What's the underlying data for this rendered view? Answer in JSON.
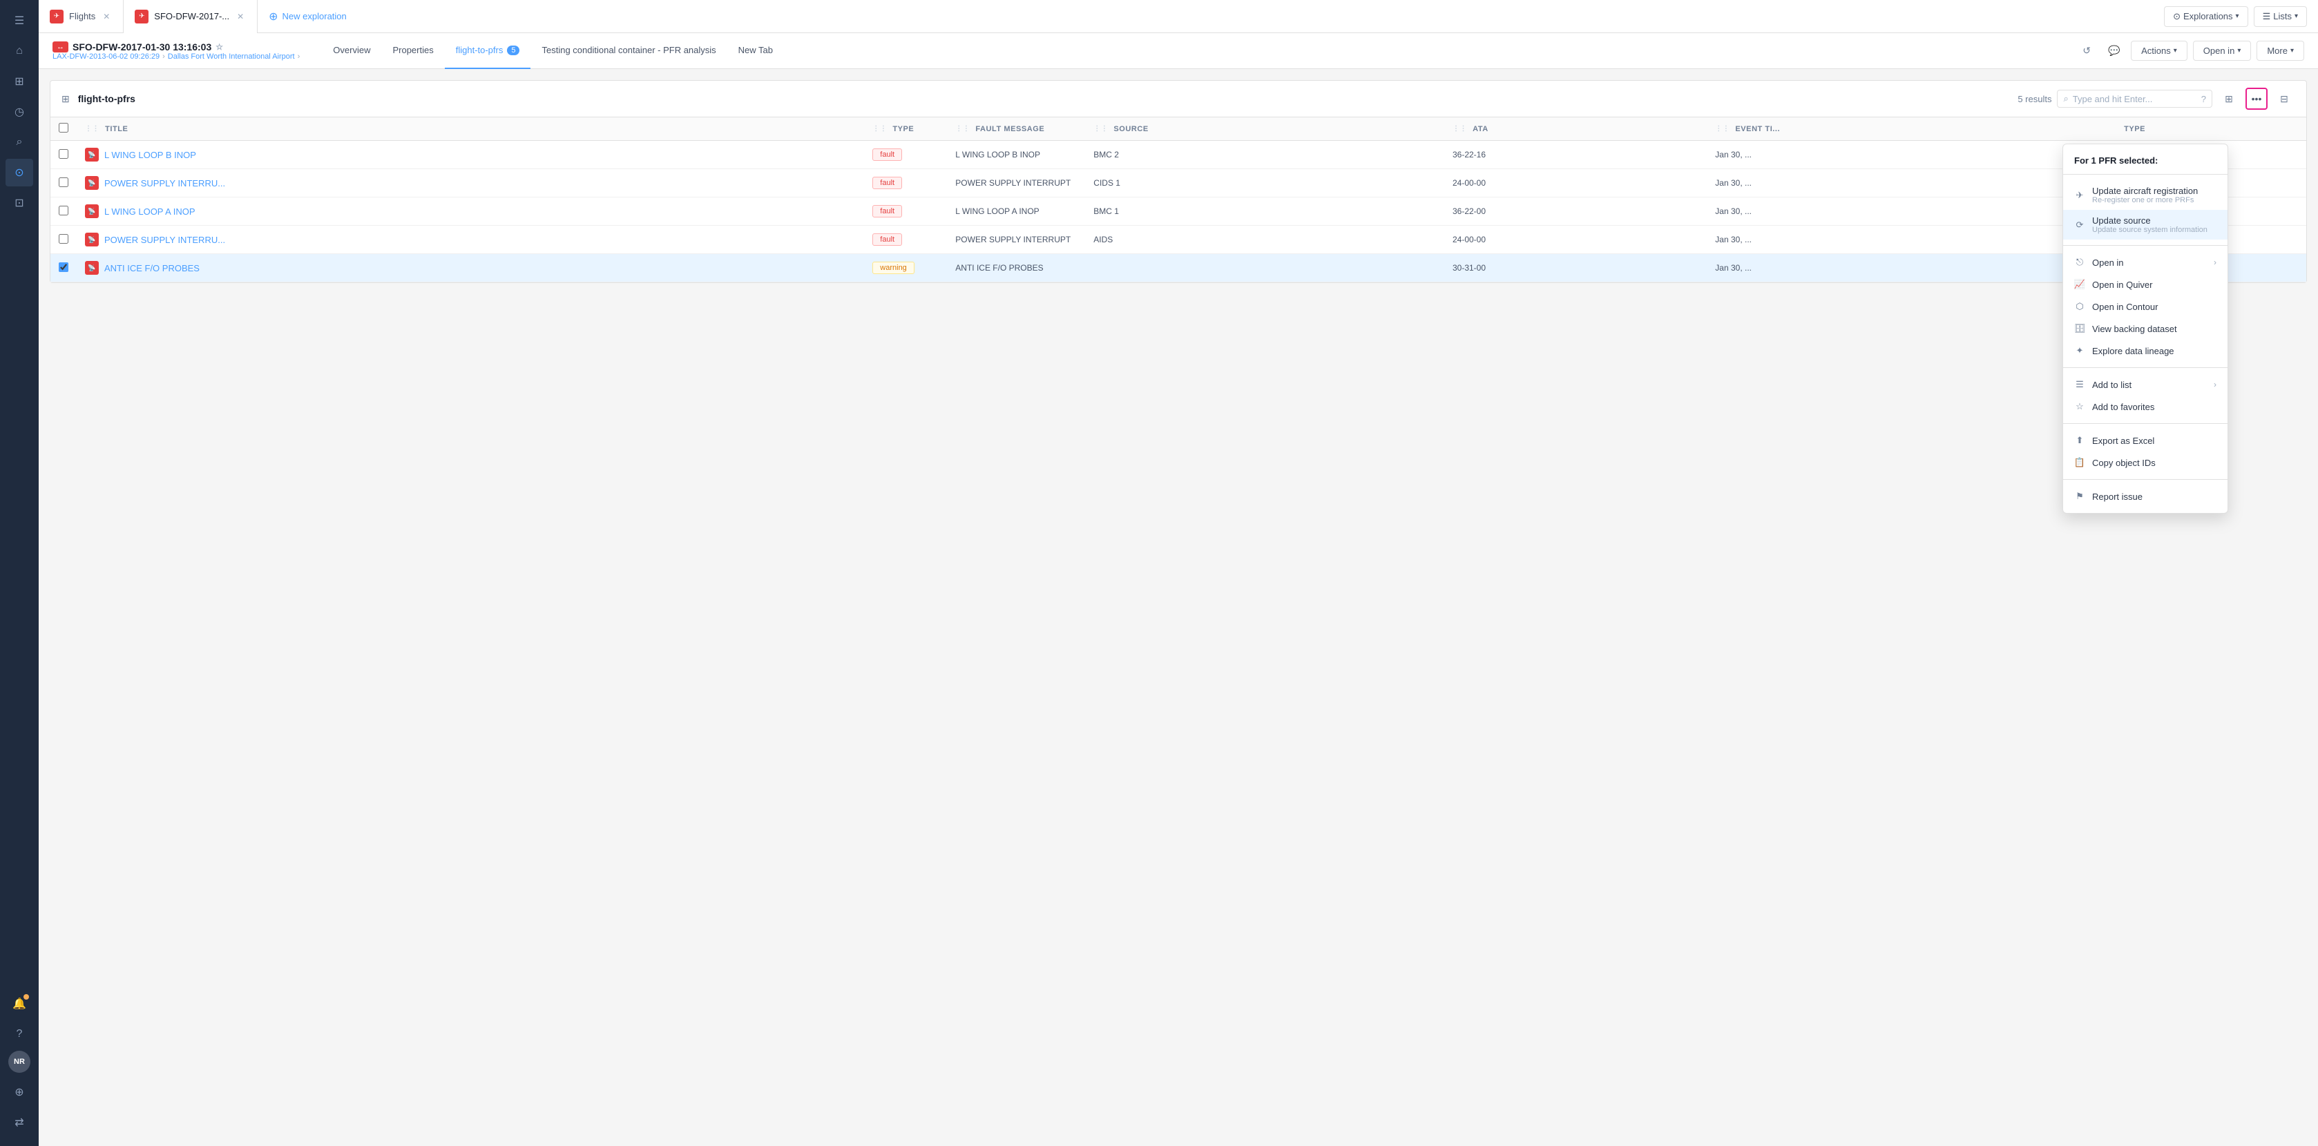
{
  "sidebar": {
    "icons": [
      {
        "name": "menu-icon",
        "symbol": "☰",
        "active": false
      },
      {
        "name": "home-icon",
        "symbol": "⌂",
        "active": false
      },
      {
        "name": "grid-icon",
        "symbol": "⊞",
        "active": false
      },
      {
        "name": "history-icon",
        "symbol": "◷",
        "active": false
      },
      {
        "name": "search-icon",
        "symbol": "⌕",
        "active": false
      },
      {
        "name": "explore-icon",
        "symbol": "⊙",
        "active": true
      },
      {
        "name": "blueprint-icon",
        "symbol": "⊡",
        "active": false
      }
    ],
    "bottom_icons": [
      {
        "name": "bell-icon",
        "symbol": "🔔"
      },
      {
        "name": "help-icon",
        "symbol": "?"
      },
      {
        "name": "user-label",
        "symbol": "NR"
      },
      {
        "name": "globe-icon",
        "symbol": "⊕"
      },
      {
        "name": "shuffle-icon",
        "symbol": "⇄"
      }
    ]
  },
  "tabs": [
    {
      "id": "flights",
      "label": "Flights",
      "icon": "✈",
      "closeable": true,
      "active": false
    },
    {
      "id": "sfo-dfw",
      "label": "SFO-DFW-2017-...",
      "icon": "✈",
      "closeable": true,
      "active": true
    },
    {
      "id": "new-exploration",
      "label": "New exploration",
      "icon": "+",
      "closeable": false,
      "active": false
    }
  ],
  "top_bar_right": {
    "explorations_label": "Explorations",
    "lists_label": "Lists"
  },
  "sub_nav": {
    "title": "SFO-DFW-2017-01-30 13:16:03",
    "star_title": "★",
    "subtitle_from": "LAX-DFW-2013-06-02 09:26:29",
    "subtitle_arrow": "→",
    "subtitle_to": "Dallas Fort Worth International Airport",
    "tabs": [
      {
        "id": "overview",
        "label": "Overview",
        "active": false
      },
      {
        "id": "properties",
        "label": "Properties",
        "active": false
      },
      {
        "id": "flight-to-pfrs",
        "label": "flight-to-pfrs",
        "badge": "5",
        "active": true
      },
      {
        "id": "testing",
        "label": "Testing conditional container - PFR analysis",
        "active": false
      },
      {
        "id": "new-tab",
        "label": "New Tab",
        "active": false
      }
    ],
    "actions_label": "Actions",
    "open_in_label": "Open in",
    "more_label": "More"
  },
  "table": {
    "title": "flight-to-pfrs",
    "results_count": "5 results",
    "search_placeholder": "Type and hit Enter...",
    "columns": [
      {
        "id": "checkbox",
        "label": ""
      },
      {
        "id": "title",
        "label": "TITLE"
      },
      {
        "id": "type",
        "label": "TYPE"
      },
      {
        "id": "fault_message",
        "label": "FAULT MESSAGE"
      },
      {
        "id": "source",
        "label": "SOURCE"
      },
      {
        "id": "ata",
        "label": "ATA"
      },
      {
        "id": "event_time",
        "label": "EVENT TI..."
      },
      {
        "id": "rtype",
        "label": "TYPE"
      }
    ],
    "rows": [
      {
        "id": 1,
        "checked": false,
        "title": "L WING LOOP B INOP",
        "type": "fault",
        "type_style": "fault",
        "fault_message": "L WING LOOP B INOP",
        "source": "BMC 2",
        "ata": "36-22-16",
        "event_time": "Jan 30, ...",
        "selected": false
      },
      {
        "id": 2,
        "checked": false,
        "title": "POWER SUPPLY INTERRU...",
        "type": "fault",
        "type_style": "fault",
        "fault_message": "POWER SUPPLY INTERRUPT",
        "source": "CIDS 1",
        "ata": "24-00-00",
        "event_time": "Jan 30, ...",
        "selected": false
      },
      {
        "id": 3,
        "checked": false,
        "title": "L WING LOOP A INOP",
        "type": "fault",
        "type_style": "fault",
        "fault_message": "L WING LOOP A INOP",
        "source": "BMC 1",
        "ata": "36-22-00",
        "event_time": "Jan 30, ...",
        "selected": false
      },
      {
        "id": 4,
        "checked": false,
        "title": "POWER SUPPLY INTERRU...",
        "type": "fault",
        "type_style": "fault",
        "fault_message": "POWER SUPPLY INTERRUPT",
        "source": "AIDS",
        "ata": "24-00-00",
        "event_time": "Jan 30, ...",
        "selected": false
      },
      {
        "id": 5,
        "checked": true,
        "title": "ANTI ICE F/O PROBES",
        "type": "warning",
        "type_style": "warning",
        "fault_message": "ANTI ICE F/O PROBES",
        "source": "",
        "ata": "30-31-00",
        "event_time": "Jan 30, ...",
        "selected": true
      }
    ]
  },
  "context_menu": {
    "header": "For 1 PFR selected:",
    "items": [
      {
        "id": "update-aircraft",
        "icon": "✈",
        "label": "Update aircraft registration",
        "sublabel": "Re-register one or more PRFs",
        "has_arrow": false
      },
      {
        "id": "update-source",
        "icon": "⟳",
        "label": "Update source",
        "sublabel": "Update source system information",
        "has_arrow": false,
        "active": true
      },
      {
        "id": "open-in",
        "icon": "",
        "label": "Open in",
        "sublabel": "",
        "has_arrow": true
      },
      {
        "id": "open-in-quiver",
        "icon": "📈",
        "label": "Open in Quiver",
        "sublabel": "",
        "has_arrow": false
      },
      {
        "id": "open-in-contour",
        "icon": "⬡",
        "label": "Open in Contour",
        "sublabel": "",
        "has_arrow": false
      },
      {
        "id": "view-backing-dataset",
        "icon": "🗄",
        "label": "View backing dataset",
        "sublabel": "",
        "has_arrow": false
      },
      {
        "id": "explore-data-lineage",
        "icon": "✦",
        "label": "Explore data lineage",
        "sublabel": "",
        "has_arrow": false
      },
      {
        "id": "add-to-list",
        "icon": "☰",
        "label": "Add to list",
        "sublabel": "",
        "has_arrow": true
      },
      {
        "id": "add-to-favorites",
        "icon": "☆",
        "label": "Add to favorites",
        "sublabel": "",
        "has_arrow": false
      },
      {
        "id": "export-excel",
        "icon": "⬆",
        "label": "Export as Excel",
        "sublabel": "",
        "has_arrow": false
      },
      {
        "id": "copy-object-ids",
        "icon": "📋",
        "label": "Copy object IDs",
        "sublabel": "",
        "has_arrow": false
      },
      {
        "id": "report-issue",
        "icon": "⚑",
        "label": "Report issue",
        "sublabel": "",
        "has_arrow": false
      }
    ]
  }
}
